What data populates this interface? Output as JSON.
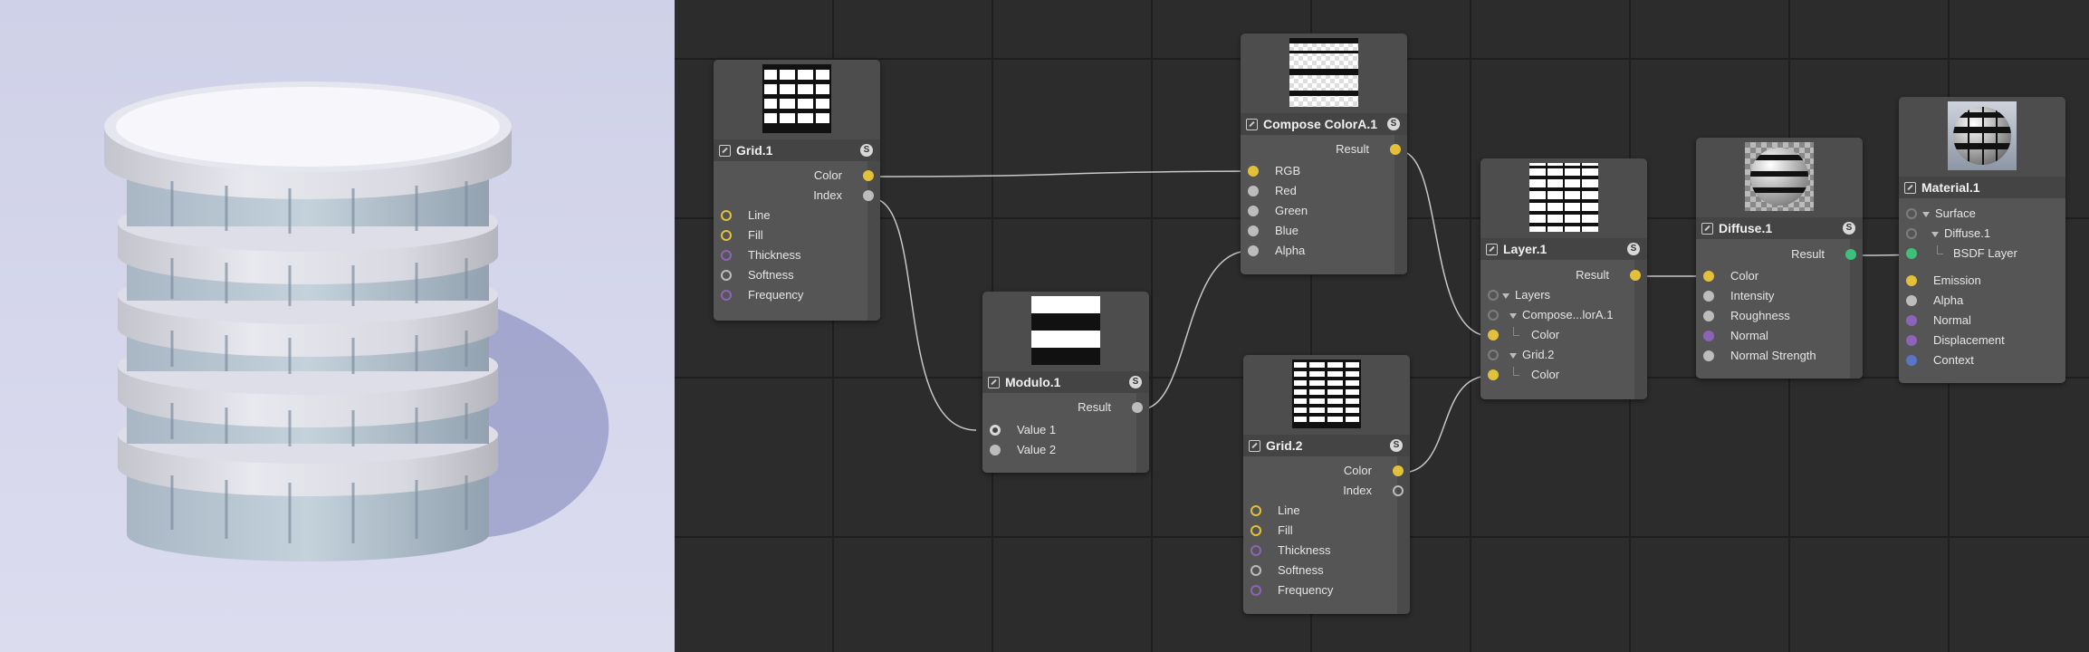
{
  "nodes": {
    "grid1": {
      "title": "Grid.1",
      "outputs": [
        "Color",
        "Index"
      ],
      "inputs": [
        "Line",
        "Fill",
        "Thickness",
        "Softness",
        "Frequency"
      ]
    },
    "compose": {
      "title": "Compose ColorA.1",
      "outputs": [
        "Result"
      ],
      "inputs": [
        "RGB",
        "Red",
        "Green",
        "Blue",
        "Alpha"
      ]
    },
    "modulo": {
      "title": "Modulo.1",
      "outputs": [
        "Result"
      ],
      "inputs": [
        "Value 1",
        "Value 2"
      ]
    },
    "grid2": {
      "title": "Grid.2",
      "outputs": [
        "Color",
        "Index"
      ],
      "inputs": [
        "Line",
        "Fill",
        "Thickness",
        "Softness",
        "Frequency"
      ]
    },
    "layer": {
      "title": "Layer.1",
      "outputs": [
        "Result"
      ],
      "inputs": [
        "Layers",
        "Compose...lorA.1",
        "Color",
        "Grid.2",
        "Color"
      ]
    },
    "diffuse": {
      "title": "Diffuse.1",
      "outputs": [
        "Result"
      ],
      "inputs": [
        "Color",
        "Intensity",
        "Roughness",
        "Normal",
        "Normal Strength"
      ]
    },
    "material": {
      "title": "Material.1",
      "inputs": [
        "Surface",
        "Diffuse.1",
        "BSDF Layer",
        "Emission",
        "Alpha",
        "Normal",
        "Displacement",
        "Context"
      ]
    }
  },
  "badge": "S",
  "colors": {
    "socket_color": "#e2c03a",
    "socket_value": "#bcbcbc",
    "socket_vector": "#8d63b8",
    "socket_bsdf": "#3ec07a",
    "socket_context": "#5a74c8",
    "wire": "#c8c8c8"
  },
  "icons": [
    "node-icon",
    "expand-triangle-icon",
    "s-badge-icon"
  ]
}
